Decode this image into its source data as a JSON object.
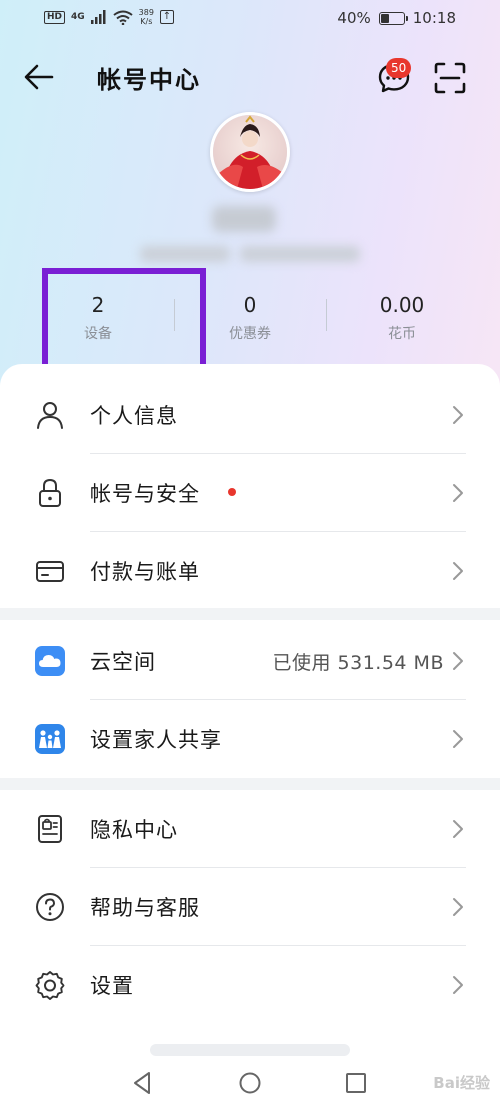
{
  "status_bar": {
    "hd": "HD",
    "network": "4G",
    "net_speed_value": "389",
    "net_speed_unit": "K/s",
    "battery_text": "40%",
    "battery_level": 0.4,
    "time": "10:18"
  },
  "header": {
    "title": "帐号中心",
    "message_badge": "50"
  },
  "stats": [
    {
      "value": "2",
      "label": "设备"
    },
    {
      "value": "0",
      "label": "优惠券"
    },
    {
      "value": "0.00",
      "label": "花币"
    }
  ],
  "menu": {
    "personal_info": "个人信息",
    "account_security": "帐号与安全",
    "payment_billing": "付款与账单",
    "cloud_space": "云空间",
    "cloud_space_value": "已使用 531.54 MB",
    "family_sharing": "设置家人共享",
    "privacy_center": "隐私中心",
    "help_service": "帮助与客服",
    "settings": "设置"
  },
  "colors": {
    "highlight_border": "#7a1fd4",
    "badge_red": "#e8362d",
    "cloud_icon_blue": "#3d8ef5"
  },
  "watermark": "Bai经验"
}
